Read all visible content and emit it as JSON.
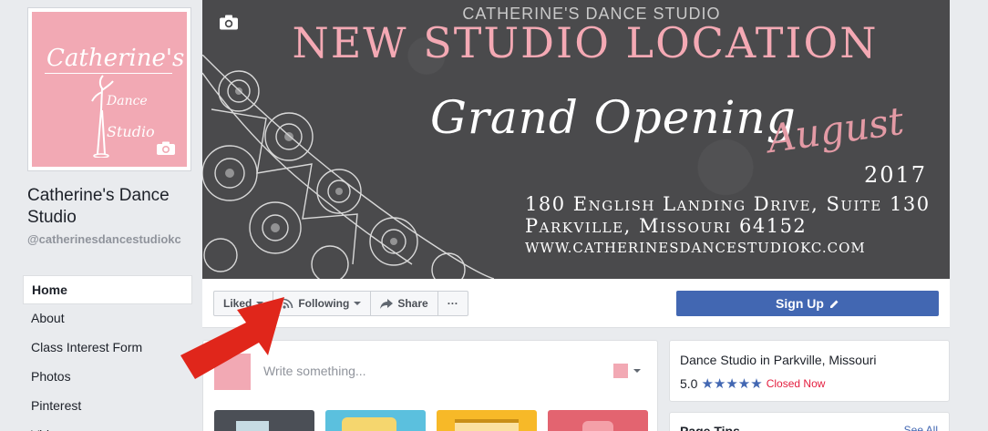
{
  "sidebar": {
    "page_name": "Catherine's Dance Studio",
    "handle": "@catherinesdancestudiokc",
    "logo": {
      "line1": "Catherine's",
      "line2": "Dance",
      "line3": "Studio"
    },
    "nav": [
      {
        "label": "Home",
        "active": true
      },
      {
        "label": "About"
      },
      {
        "label": "Class Interest Form"
      },
      {
        "label": "Photos"
      },
      {
        "label": "Pinterest"
      },
      {
        "label": "Videos"
      }
    ]
  },
  "cover": {
    "studio": "CATHERINE'S DANCE STUDIO",
    "headline": "NEW STUDIO LOCATION",
    "grand": "Grand Opening",
    "month": "August",
    "year": "2017",
    "address1": "180 English Landing Drive, Suite 130",
    "address2": "Parkville, Missouri 64152",
    "website": "WWW.CATHERINESDANCESTUDIOKC.COM"
  },
  "actions": {
    "liked_label": "Liked",
    "following_label": "Following",
    "share_label": "Share",
    "more_label": "···",
    "signup_label": "Sign Up"
  },
  "composer": {
    "placeholder": "Write something..."
  },
  "info": {
    "category": "Dance Studio in Parkville, Missouri",
    "rating": "5.0",
    "stars": "★★★★★",
    "status": "Closed Now"
  },
  "tips": {
    "title": "Page Tips",
    "see_all": "See All"
  },
  "colors": {
    "brand_pink": "#f2a9b4",
    "fb_blue": "#4267b2",
    "cover_gray": "#4a4a4c",
    "arrow_red": "#e0261b"
  }
}
